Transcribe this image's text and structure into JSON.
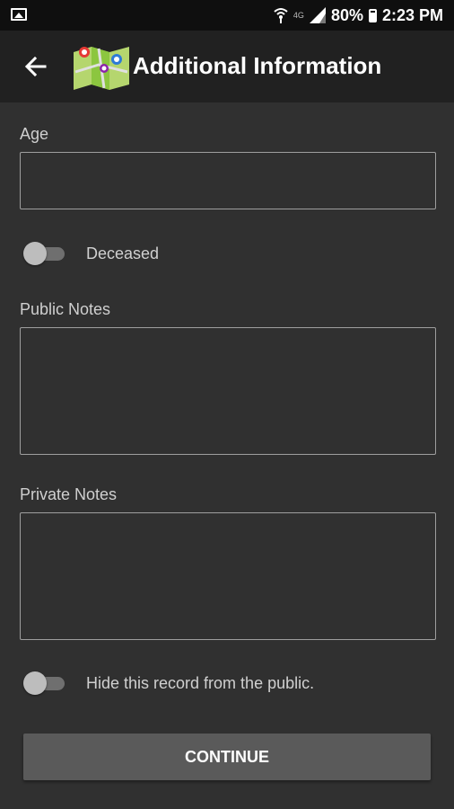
{
  "status_bar": {
    "network": "4G",
    "battery": "80%",
    "time": "2:23 PM",
    "icons": [
      "image-icon",
      "wifi-icon",
      "signal-icon",
      "battery-icon"
    ]
  },
  "app_bar": {
    "title": "Additional Information",
    "back_icon": "back-arrow-icon",
    "logo_icon": "map-logo-icon"
  },
  "form": {
    "age": {
      "label": "Age",
      "value": ""
    },
    "deceased": {
      "label": "Deceased",
      "on": false
    },
    "public_notes": {
      "label": "Public Notes",
      "value": ""
    },
    "private_notes": {
      "label": "Private Notes",
      "value": ""
    },
    "hide_record": {
      "label": "Hide this record from the public.",
      "on": false
    },
    "continue_label": "CONTINUE"
  },
  "colors": {
    "background": "#303030",
    "app_bar": "#212121",
    "button": "#5a5a5a"
  }
}
